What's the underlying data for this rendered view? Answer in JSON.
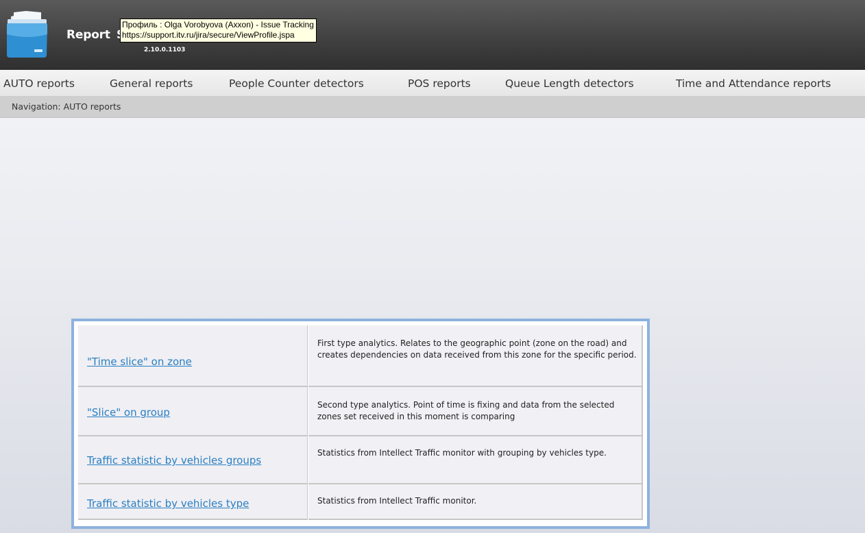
{
  "header": {
    "title": "Report",
    "title_tail": "S",
    "version": "2.10.0.1103"
  },
  "tooltip": {
    "line1": "Профиль : Olga Vorobyova (Axxon) - Issue Tracking",
    "line2": "https://support.itv.ru/jira/secure/ViewProfile.jspa"
  },
  "menu": {
    "items": [
      {
        "label": "AUTO reports"
      },
      {
        "label": "General reports"
      },
      {
        "label": "People Counter detectors"
      },
      {
        "label": "POS reports"
      },
      {
        "label": "Queue Length detectors"
      },
      {
        "label": "Time and Attendance reports"
      }
    ]
  },
  "navigation": {
    "text": "Navigation: AUTO reports"
  },
  "reports": [
    {
      "link": "\"Time slice\" on zone",
      "description": "First type analytics. Relates to the geographic point (zone on the road) and creates dependencies on data received from this zone for the specific period."
    },
    {
      "link": "\"Slice\" on group",
      "description": "Second type analytics. Point of time is fixing and data from the selected zones set received in this moment is comparing"
    },
    {
      "link": "Traffic statistic by vehicles groups",
      "description": "Statistics from Intellect Traffic monitor with grouping by vehicles type."
    },
    {
      "link": "Traffic statistic by vehicles type",
      "description": "Statistics from Intellect Traffic monitor."
    }
  ],
  "icons": {
    "logo": "folder-icon"
  },
  "colors": {
    "header_bg": "#3f3f3f",
    "menu_bg": "#ececec",
    "nav_bg": "#cfcfcf",
    "link": "#2a7fc1",
    "table_border": "#8db2dd",
    "tooltip_bg": "#ffffe1"
  }
}
